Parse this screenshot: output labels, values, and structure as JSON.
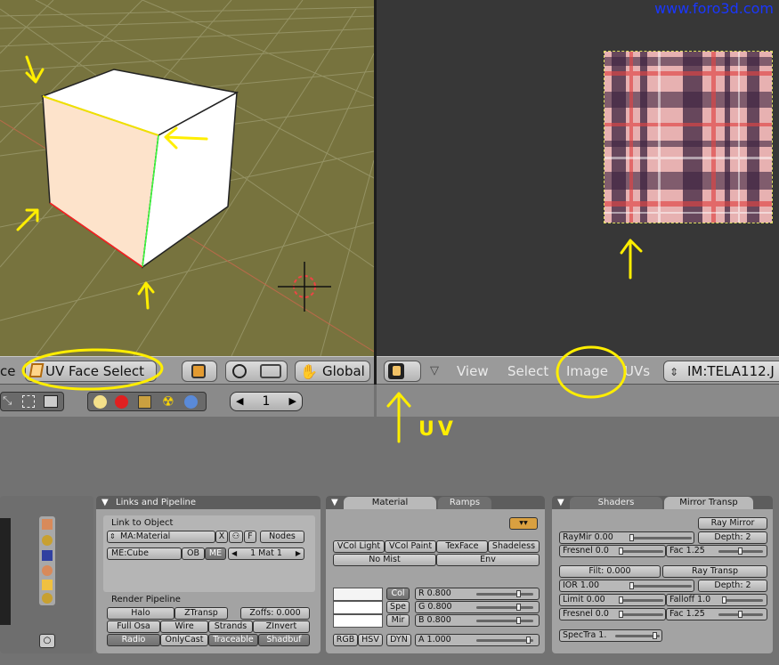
{
  "watermark": "www.foro3d.com",
  "viewport3d": {
    "mode_fragment": "ce",
    "mode_select": "UV Face Select",
    "orientation": "Global"
  },
  "image_editor": {
    "menus": [
      "View",
      "Select",
      "Image",
      "UVs"
    ],
    "image_name": "IM:TELA112.J"
  },
  "annotation": {
    "label": "UV"
  },
  "subheader": {
    "layer_value": "1"
  },
  "links_panel": {
    "title": "Links and Pipeline",
    "link_to_object": "Link to Object",
    "material_field": "MA:Material",
    "x_btn": "X",
    "f_btn": "F",
    "nodes_btn": "Nodes",
    "mesh_field": "ME:Cube",
    "ob_btn": "OB",
    "me_btn": "ME",
    "mat_count": "1 Mat 1",
    "render_pipeline": "Render Pipeline",
    "pipeline_rows": [
      [
        "Halo",
        "ZTransp",
        "Zoffs: 0.000"
      ],
      [
        "Full Osa",
        "Wire",
        "Strands",
        "ZInvert"
      ],
      [
        "Radio",
        "OnlyCast",
        "Traceable",
        "Shadbuf"
      ]
    ]
  },
  "material_panel": {
    "tabs": [
      "Material",
      "Ramps"
    ],
    "vcol_row": [
      "VCol Light",
      "VCol Paint",
      "TexFace",
      "Shadeless"
    ],
    "mist_row": [
      "No Mist",
      "Env"
    ],
    "color_buttons": [
      "Col",
      "Spe",
      "Mir"
    ],
    "r": "R 0.800",
    "g": "G 0.800",
    "b": "B 0.800",
    "a": "A 1.000",
    "r_val": 0.8,
    "g_val": 0.8,
    "b_val": 0.8,
    "a_val": 1.0,
    "model_buttons": [
      "RGB",
      "HSV",
      "DYN"
    ]
  },
  "shaders_panel": {
    "tabs": [
      "Shaders",
      "Mirror Transp"
    ],
    "ray_mirror": "Ray Mirror",
    "raymir": "RayMir 0.00",
    "depth1": "Depth: 2",
    "fresnel1": "Fresnel 0.0",
    "fac1": "Fac 1.25",
    "filt": "Filt: 0.000",
    "ray_transp": "Ray Transp",
    "ior": "IOR 1.00",
    "depth2": "Depth: 2",
    "limit": "Limit 0.00",
    "falloff": "Falloff 1.0",
    "fresnel2": "Fresnel 0.0",
    "fac2": "Fac 1.25",
    "spectra": "SpecTra 1."
  },
  "colors": {
    "viewport_bg": "#77733e",
    "image_bg": "#373737",
    "annotation": "#ffee00",
    "watermark": "#1a37ff"
  }
}
